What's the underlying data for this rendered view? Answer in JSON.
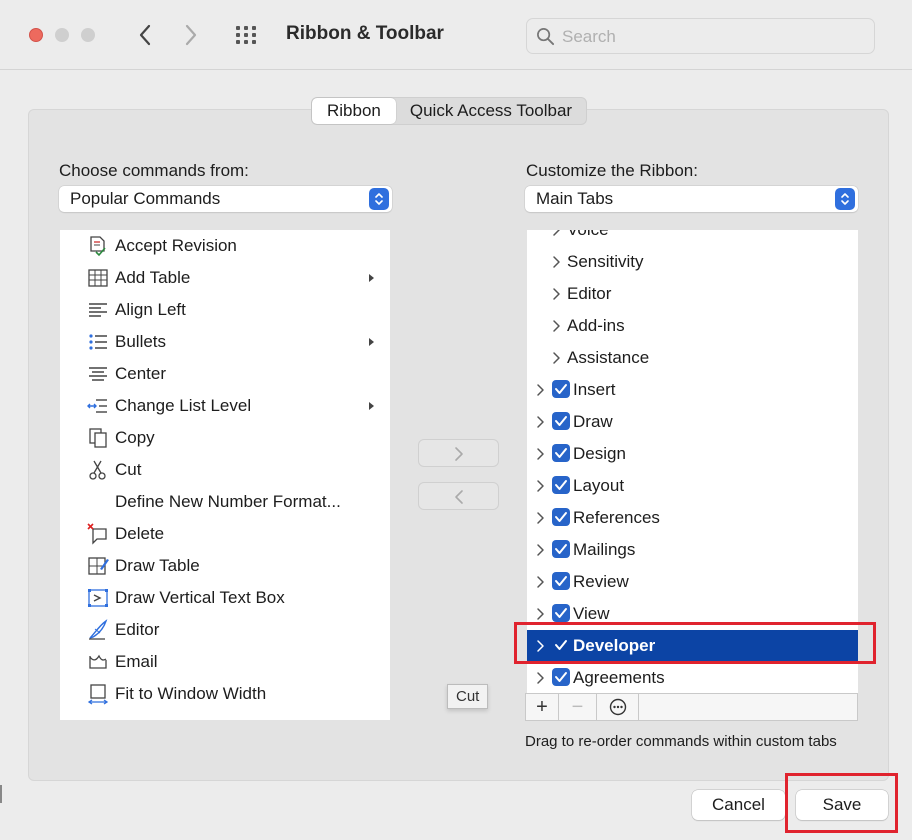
{
  "window": {
    "title": "Ribbon & Toolbar",
    "search_placeholder": "Search"
  },
  "segments": {
    "ribbon": "Ribbon",
    "quick_access": "Quick Access Toolbar"
  },
  "left": {
    "label": "Choose commands from:",
    "popup_value": "Popular Commands",
    "commands": [
      {
        "label": "Accept Revision",
        "icon": "accept-revision-icon",
        "submenu": false
      },
      {
        "label": "Add Table",
        "icon": "table-icon",
        "submenu": true
      },
      {
        "label": "Align Left",
        "icon": "align-left-icon",
        "submenu": false
      },
      {
        "label": "Bullets",
        "icon": "bullets-icon",
        "submenu": true
      },
      {
        "label": "Center",
        "icon": "align-center-icon",
        "submenu": false
      },
      {
        "label": "Change List Level",
        "icon": "list-level-icon",
        "submenu": true
      },
      {
        "label": "Copy",
        "icon": "copy-icon",
        "submenu": false
      },
      {
        "label": "Cut",
        "icon": "scissors-icon",
        "submenu": false
      },
      {
        "label": "Define New Number Format...",
        "icon": "",
        "submenu": false
      },
      {
        "label": "Delete",
        "icon": "delete-comment-icon",
        "submenu": false
      },
      {
        "label": "Draw Table",
        "icon": "draw-table-icon",
        "submenu": false
      },
      {
        "label": "Draw Vertical Text Box",
        "icon": "vertical-textbox-icon",
        "submenu": false
      },
      {
        "label": "Editor",
        "icon": "editor-pen-icon",
        "submenu": false
      },
      {
        "label": "Email",
        "icon": "email-icon",
        "submenu": false
      },
      {
        "label": "Fit to Window Width",
        "icon": "fit-width-icon",
        "submenu": false
      }
    ]
  },
  "right": {
    "label": "Customize the Ribbon:",
    "popup_value": "Main Tabs",
    "tabs": [
      {
        "label": "Voice",
        "level": 2,
        "checkbox": false,
        "checked": false,
        "selected": false
      },
      {
        "label": "Sensitivity",
        "level": 2,
        "checkbox": false,
        "checked": false,
        "selected": false
      },
      {
        "label": "Editor",
        "level": 2,
        "checkbox": false,
        "checked": false,
        "selected": false
      },
      {
        "label": "Add-ins",
        "level": 2,
        "checkbox": false,
        "checked": false,
        "selected": false
      },
      {
        "label": "Assistance",
        "level": 2,
        "checkbox": false,
        "checked": false,
        "selected": false
      },
      {
        "label": "Insert",
        "level": 1,
        "checkbox": true,
        "checked": true,
        "selected": false
      },
      {
        "label": "Draw",
        "level": 1,
        "checkbox": true,
        "checked": true,
        "selected": false
      },
      {
        "label": "Design",
        "level": 1,
        "checkbox": true,
        "checked": true,
        "selected": false
      },
      {
        "label": "Layout",
        "level": 1,
        "checkbox": true,
        "checked": true,
        "selected": false
      },
      {
        "label": "References",
        "level": 1,
        "checkbox": true,
        "checked": true,
        "selected": false
      },
      {
        "label": "Mailings",
        "level": 1,
        "checkbox": true,
        "checked": true,
        "selected": false
      },
      {
        "label": "Review",
        "level": 1,
        "checkbox": true,
        "checked": true,
        "selected": false
      },
      {
        "label": "View",
        "level": 1,
        "checkbox": true,
        "checked": true,
        "selected": false
      },
      {
        "label": "Developer",
        "level": 1,
        "checkbox": true,
        "checked": true,
        "selected": true
      },
      {
        "label": "Agreements",
        "level": 1,
        "checkbox": true,
        "checked": true,
        "selected": false
      }
    ],
    "toolbar": {
      "add": "+",
      "remove": "−",
      "more": "⊖"
    },
    "hint": "Drag to re-order commands within custom tabs"
  },
  "tooltip": "Cut",
  "buttons": {
    "cancel": "Cancel",
    "save": "Save"
  },
  "colors": {
    "accent": "#2f6fde",
    "selection": "#0c44a5",
    "highlight_box": "#e0232e",
    "close_light": "#ed6a5e"
  }
}
